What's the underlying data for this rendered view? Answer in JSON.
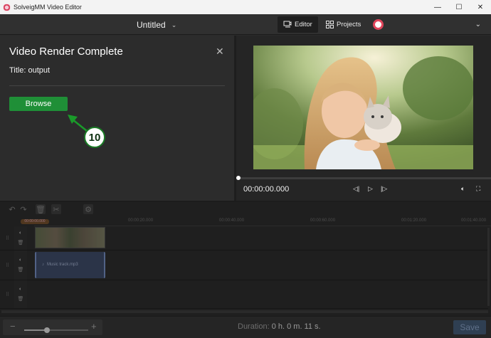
{
  "window": {
    "title": "SolveigMM Video Editor",
    "minimize": "—",
    "maximize": "☐",
    "close": "✕"
  },
  "header": {
    "project_title": "Untitled",
    "tabs": [
      {
        "label": "Editor",
        "active": true
      },
      {
        "label": "Projects",
        "active": false
      }
    ]
  },
  "render_panel": {
    "heading": "Video Render Complete",
    "subtitle": "Title: output",
    "browse_label": "Browse",
    "step_number": "10"
  },
  "preview": {
    "timecode": "00:00:00.000",
    "playback_progress": 0
  },
  "timeline": {
    "ruler_ticks": [
      "00:00:20.000",
      "00:00:40.000",
      "00:00:60.000",
      "00:01:20.000",
      "00:01:40.000"
    ],
    "playhead_label": "00:00:00.000",
    "audio_clip_label": "Music track.mp3"
  },
  "footer": {
    "duration_label": "Duration:",
    "duration_value": "0 h. 0 m. 11 s.",
    "save_label": "Save",
    "zoom_level": 0.35
  },
  "colors": {
    "accent_green": "#1f8f37",
    "avatar_ring": "#e0455b"
  }
}
